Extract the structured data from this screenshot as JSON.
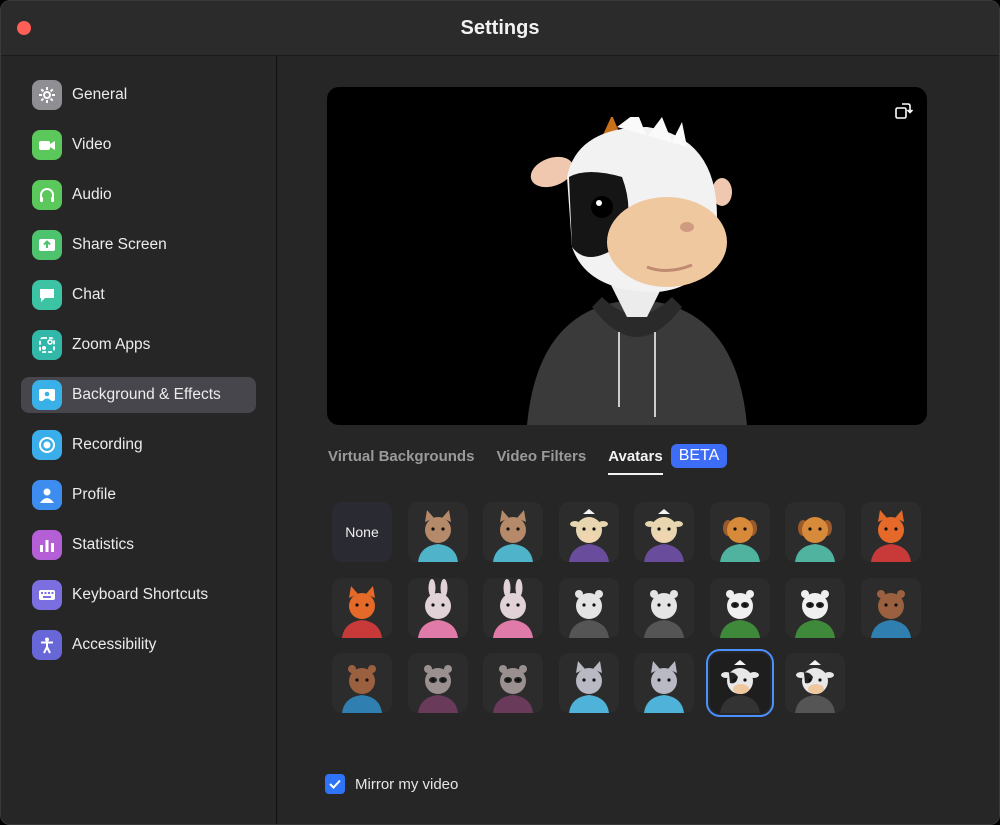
{
  "window": {
    "title": "Settings"
  },
  "sidebar": {
    "items": [
      {
        "label": "General",
        "icon": "gear-icon",
        "color": "#8e8e93"
      },
      {
        "label": "Video",
        "icon": "video-camera-icon",
        "color": "#5ac85a"
      },
      {
        "label": "Audio",
        "icon": "headphones-icon",
        "color": "#5ac85a"
      },
      {
        "label": "Share Screen",
        "icon": "share-screen-icon",
        "color": "#4cc36c"
      },
      {
        "label": "Chat",
        "icon": "chat-bubble-icon",
        "color": "#3bc3a4"
      },
      {
        "label": "Zoom Apps",
        "icon": "apps-icon",
        "color": "#32b8a8"
      },
      {
        "label": "Background & Effects",
        "icon": "background-icon",
        "color": "#3ab0e8"
      },
      {
        "label": "Recording",
        "icon": "record-icon",
        "color": "#3aaeea"
      },
      {
        "label": "Profile",
        "icon": "person-icon",
        "color": "#3d8df0"
      },
      {
        "label": "Statistics",
        "icon": "bar-chart-icon",
        "color": "#b45fd6"
      },
      {
        "label": "Keyboard Shortcuts",
        "icon": "keyboard-icon",
        "color": "#7b6ee0"
      },
      {
        "label": "Accessibility",
        "icon": "accessibility-icon",
        "color": "#6767d8"
      }
    ],
    "active_index": 6
  },
  "tabs": {
    "virtual_backgrounds": "Virtual Backgrounds",
    "video_filters": "Video Filters",
    "avatars": "Avatars",
    "beta": "BETA"
  },
  "avatars": {
    "none_label": "None",
    "selected_index": 20,
    "items": [
      {
        "animal": "cat",
        "fur": "#b58a6a",
        "cloth": "#4fb3c9"
      },
      {
        "animal": "cat",
        "fur": "#b58a6a",
        "cloth": "#4fb3c9"
      },
      {
        "animal": "cow",
        "fur": "#e8d6b0",
        "cloth": "#6a4c9c"
      },
      {
        "animal": "cow",
        "fur": "#e8d6b0",
        "cloth": "#6a4c9c"
      },
      {
        "animal": "dog",
        "fur": "#d78a3a",
        "cloth": "#4fb3a0"
      },
      {
        "animal": "dog",
        "fur": "#d78a3a",
        "cloth": "#4fb3a0"
      },
      {
        "animal": "fox",
        "fur": "#e56a2a",
        "cloth": "#c83a3a"
      },
      {
        "animal": "fox",
        "fur": "#e56a2a",
        "cloth": "#c83a3a"
      },
      {
        "animal": "rabbit",
        "fur": "#e0d2d6",
        "cloth": "#e07aa8"
      },
      {
        "animal": "rabbit",
        "fur": "#e0d2d6",
        "cloth": "#e07aa8"
      },
      {
        "animal": "bear",
        "fur": "#e4e4e4",
        "cloth": "#555555"
      },
      {
        "animal": "bear",
        "fur": "#e4e4e4",
        "cloth": "#555555"
      },
      {
        "animal": "panda",
        "fur": "#f0f0f0",
        "cloth": "#3f8a3a"
      },
      {
        "animal": "panda",
        "fur": "#f0f0f0",
        "cloth": "#3f8a3a"
      },
      {
        "animal": "otter",
        "fur": "#9a6040",
        "cloth": "#2f7fb0"
      },
      {
        "animal": "otter",
        "fur": "#9a6040",
        "cloth": "#2f7fb0"
      },
      {
        "animal": "raccoon",
        "fur": "#9a9090",
        "cloth": "#6a3a5a"
      },
      {
        "animal": "raccoon",
        "fur": "#9a9090",
        "cloth": "#6a3a5a"
      },
      {
        "animal": "kitten",
        "fur": "#b9b9c4",
        "cloth": "#4fb3d9"
      },
      {
        "animal": "kitten",
        "fur": "#b9b9c4",
        "cloth": "#4fb3d9"
      },
      {
        "animal": "cow-bw",
        "fur": "#e8e8e8",
        "cloth": "#333333"
      },
      {
        "animal": "cow-bw",
        "fur": "#e8e8e8",
        "cloth": "#555555"
      }
    ]
  },
  "mirror": {
    "label": "Mirror my video",
    "checked": true
  },
  "colors": {
    "accent": "#3d6cf7",
    "selection": "#4a90ff",
    "checkbox": "#2f73f7"
  }
}
